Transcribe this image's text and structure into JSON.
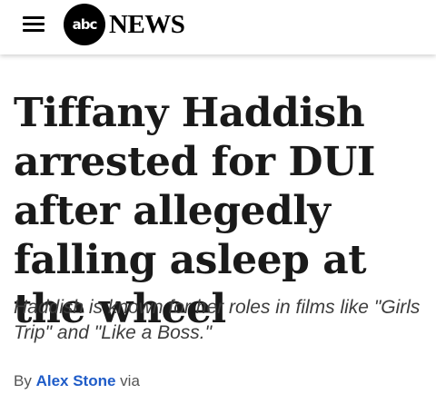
{
  "header": {
    "menu_icon": "hamburger-menu-icon",
    "logo": {
      "circle_text": "abc",
      "word_text": "NEWS"
    }
  },
  "article": {
    "headline": "Tiffany Haddish arrested for DUI after allegedly falling asleep at the wheel",
    "dek": "Haddish is known for her roles in films like \"Girls Trip\" and \"Like a Boss.\"",
    "byline": {
      "prefix": "By",
      "author": "Alex Stone",
      "suffix": "via"
    }
  },
  "colors": {
    "author_link": "#1f5cc8",
    "headline": "#1a1a1a",
    "dek": "#3d3d3d"
  }
}
